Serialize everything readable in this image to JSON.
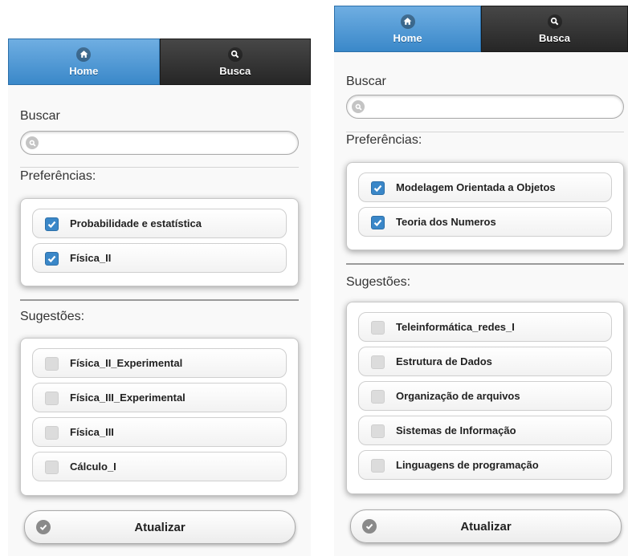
{
  "screen1": {
    "nav": {
      "home": "Home",
      "busca": "Busca"
    },
    "buscar_label": "Buscar",
    "search": {
      "value": "",
      "placeholder": ""
    },
    "preferencias_label": "Preferências:",
    "preferencias": [
      {
        "label": "Probabilidade e estatística",
        "checked": true
      },
      {
        "label": "Física_II",
        "checked": true
      }
    ],
    "sugestoes_label": "Sugestões:",
    "sugestoes": [
      {
        "label": "Física_II_Experimental",
        "checked": false
      },
      {
        "label": "Física_III_Experimental",
        "checked": false
      },
      {
        "label": "Física_III",
        "checked": false
      },
      {
        "label": "Cálculo_I",
        "checked": false
      }
    ],
    "button": "Atualizar"
  },
  "screen2": {
    "nav": {
      "home": "Home",
      "busca": "Busca"
    },
    "buscar_label": "Buscar",
    "search": {
      "value": "",
      "placeholder": ""
    },
    "preferencias_label": "Preferências:",
    "preferencias": [
      {
        "label": "Modelagem Orientada a Objetos",
        "checked": true
      },
      {
        "label": "Teoria dos Numeros",
        "checked": true
      }
    ],
    "sugestoes_label": "Sugestões:",
    "sugestoes": [
      {
        "label": "Teleinformática_redes_I",
        "checked": false
      },
      {
        "label": "Estrutura de Dados",
        "checked": false
      },
      {
        "label": "Organização de arquivos",
        "checked": false
      },
      {
        "label": "Sistemas de Informação",
        "checked": false
      },
      {
        "label": "Linguagens de programação",
        "checked": false
      }
    ],
    "button": "Atualizar"
  },
  "colors": {
    "active_tab": "#3a88c9",
    "inactive_tab": "#333333",
    "checkbox_on": "#3a87c8",
    "checkbox_off": "#dcdcdc"
  },
  "icons": {
    "home": "home-icon",
    "busca": "search-icon",
    "button": "check-circle-icon"
  }
}
